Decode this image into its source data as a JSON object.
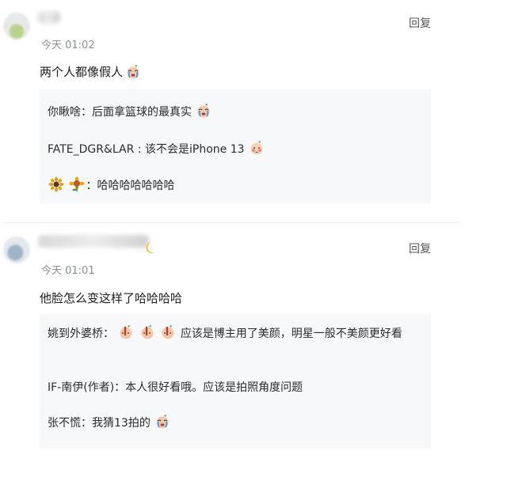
{
  "comments": [
    {
      "time": "今天 01:02",
      "reply_label": "回复",
      "text": "两个人都像假人",
      "replies": [
        {
          "user": "你瞅啥",
          "sep": "：",
          "text": "后面拿篮球的最真实"
        },
        {
          "user": "FATE_DGR&LAR",
          "sep": " : ",
          "text": "该不会是iPhone 13"
        },
        {
          "user": "",
          "sep": "：",
          "text": "哈哈哈哈哈哈哈"
        }
      ]
    },
    {
      "time": "今天 01:01",
      "reply_label": "回复",
      "text": "他脸怎么变这样了哈哈哈哈",
      "replies": [
        {
          "user": "姚到外婆桥",
          "sep": "：",
          "text": "应该是博主用了美颜，明星一般不美颜更好看"
        },
        {
          "user": "IF-南伊(作者)",
          "sep": "：",
          "text": "本人很好看哦。应该是拍照角度问题"
        },
        {
          "user": "张不慌",
          "sep": "：",
          "text": "我猜13拍的"
        }
      ]
    }
  ],
  "icons": {
    "crying": "crying-emoji-icon",
    "shy": "shy-emoji-icon",
    "sunflower": "sunflower-icon",
    "pointing": "pointing-emoji-icon",
    "moon": "moon-icon"
  },
  "colors": {
    "time": "#8a8f96",
    "reply_box": "#f7f8fa"
  }
}
